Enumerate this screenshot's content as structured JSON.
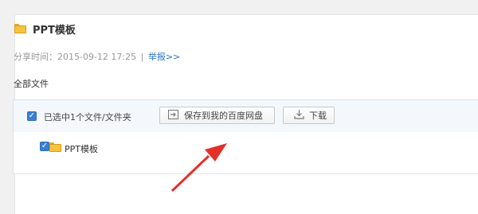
{
  "title": {
    "text": "PPT模板",
    "icon": "folder-icon"
  },
  "share": {
    "label": "分享时间：",
    "time": "2015-09-12 17:25",
    "separator": "|",
    "report_link": "举报>>"
  },
  "section_label": "全部文件",
  "toolbar": {
    "selected_text": "已选中1个文件/文件夹",
    "save_button": "保存到我的百度网盘",
    "download_button": "下载",
    "checkbox_checked": true
  },
  "files": [
    {
      "name": "PPT模板",
      "type": "folder",
      "checked": true
    }
  ],
  "colors": {
    "accent": "#3a7fd3",
    "arrow": "#e2312b",
    "folder": "#f6c33f",
    "link": "#2a72c5"
  }
}
